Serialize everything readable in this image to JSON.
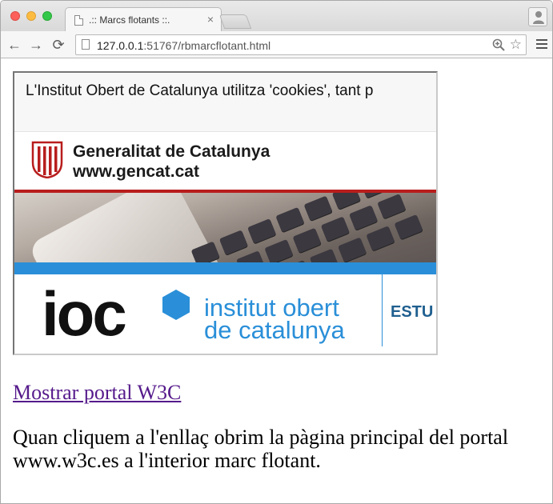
{
  "browser": {
    "tab_title": ".:: Marcs flotants ::.",
    "tab_close": "×",
    "url_host": "127.0.0.1",
    "url_rest": ":51767/rbmarcflotant.html",
    "back": "←",
    "forward": "→",
    "reload": "⟳",
    "star": "☆"
  },
  "iframe": {
    "cookie_text": "L'Institut Obert de Catalunya utilitza 'cookies', tant p",
    "gencat_name": "Generalitat de Catalunya",
    "gencat_url": "www.gencat.cat",
    "ioc_logo_text": "ioc",
    "institut_line1": "institut obert",
    "institut_line2": "de catalunya",
    "estu": "ESTU"
  },
  "page": {
    "link_text": "Mostrar portal W3C",
    "description": "Quan cliquem a l'enllaç obrim la pàgina principal del portal www.w3c.es a l'interior marc flotant."
  },
  "colors": {
    "gencat_red": "#b81d1d",
    "ioc_blue": "#2a8fd8",
    "visited_link": "#551a8b"
  },
  "icons": [
    "page-icon",
    "close-icon",
    "profile-icon",
    "back-icon",
    "forward-icon",
    "reload-icon",
    "zoom-icon",
    "star-icon",
    "menu-icon",
    "gencat-logo-icon",
    "hexagon-icon"
  ]
}
